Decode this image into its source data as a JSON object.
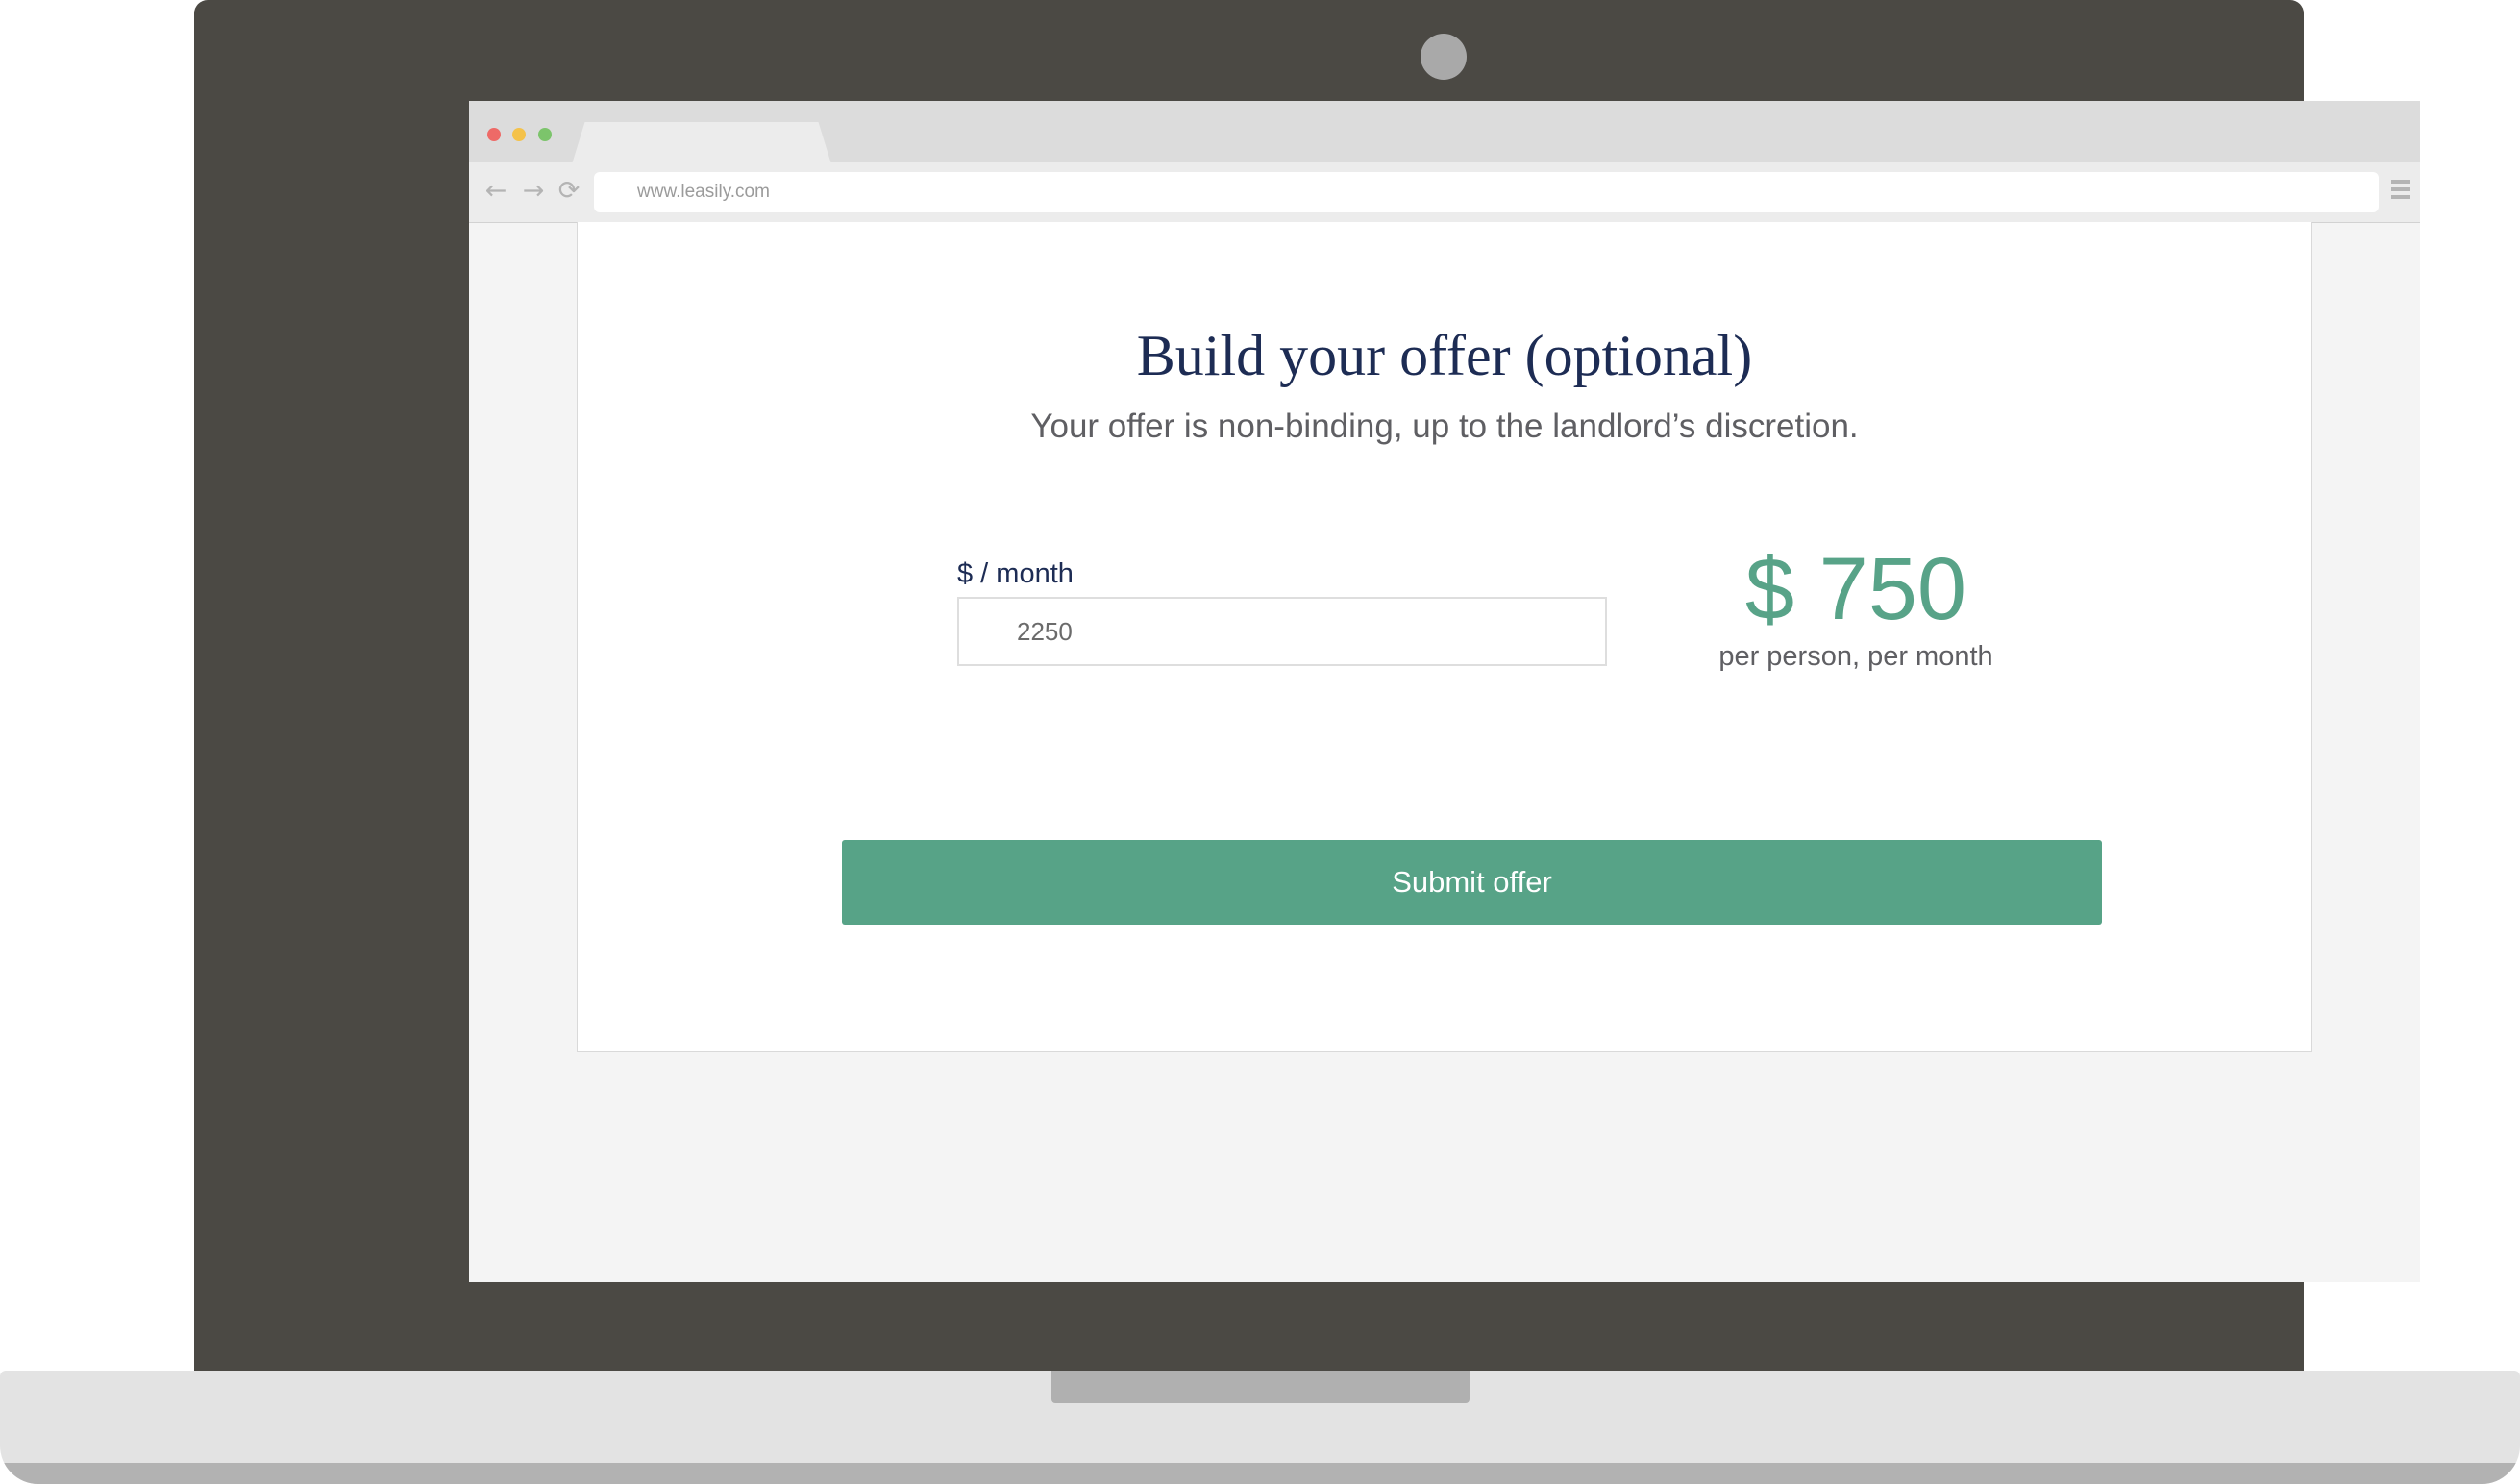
{
  "browser": {
    "url": "www.leasily.com",
    "icons": {
      "back": "back-arrow-icon",
      "forward": "forward-arrow-icon",
      "reload": "reload-icon",
      "menu": "hamburger-menu-icon"
    }
  },
  "offer": {
    "title": "Build your offer (optional)",
    "subtitle": "Your offer is non-binding, up to the landlord’s discretion.",
    "field_label": "$ / month",
    "field_value": "2250",
    "per_person_value": "$ 750",
    "per_person_caption": "per person, per month",
    "submit_label": "Submit offer"
  },
  "colors": {
    "accent": "#57a387",
    "title": "#1d2c54",
    "laptop_frame": "#4b4944"
  }
}
